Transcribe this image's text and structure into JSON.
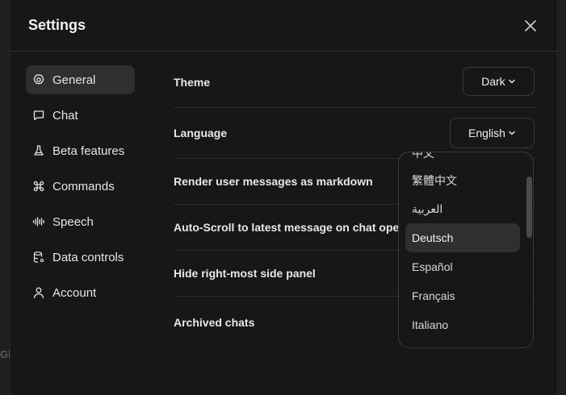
{
  "backdrop": {
    "text": "Gl"
  },
  "modal": {
    "title": "Settings"
  },
  "sidebar": {
    "items": [
      {
        "label": "General",
        "icon": "gear-icon"
      },
      {
        "label": "Chat",
        "icon": "chat-bubble-icon"
      },
      {
        "label": "Beta features",
        "icon": "flask-icon"
      },
      {
        "label": "Commands",
        "icon": "command-icon"
      },
      {
        "label": "Speech",
        "icon": "waveform-icon"
      },
      {
        "label": "Data controls",
        "icon": "database-icon"
      },
      {
        "label": "Account",
        "icon": "user-icon"
      }
    ],
    "active_index": 0
  },
  "settings": {
    "theme": {
      "label": "Theme",
      "value": "Dark"
    },
    "language": {
      "label": "Language",
      "value": "English"
    },
    "render_markdown": {
      "label": "Render user messages as markdown"
    },
    "auto_scroll": {
      "label": "Auto-Scroll to latest message on chat open"
    },
    "hide_panel": {
      "label": "Hide right-most side panel"
    },
    "archived": {
      "label": "Archived chats"
    }
  },
  "language_menu": {
    "options": [
      "中文",
      "繁體中文",
      "العربية",
      "Deutsch",
      "Español",
      "Français",
      "Italiano"
    ],
    "highlighted": "Deutsch"
  },
  "colors": {
    "background": "#171717",
    "active_item": "#2f2f2f",
    "border": "#3a3a3a",
    "text": "#ececec"
  }
}
